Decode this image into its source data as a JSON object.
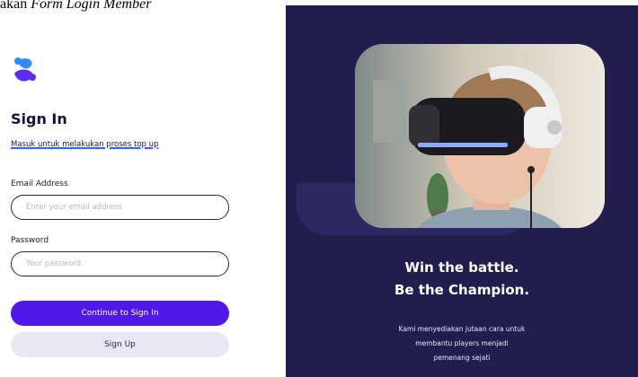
{
  "caption": {
    "prefix": "akan ",
    "form_italic": "Form",
    "login_italic": " Login Member"
  },
  "colors": {
    "primary": "#5118ea",
    "panel_bg": "#221d4c",
    "title": "#150e3f",
    "secondary_btn": "#e9e8f4",
    "accent_underline": "#2f68ff"
  },
  "login": {
    "logo_icon": "brand-s-logo-icon",
    "title": "Sign In",
    "subtitle": "Masuk untuk melakukan proses top up",
    "email": {
      "label": "Email Address",
      "placeholder": "Enter your email address",
      "value": ""
    },
    "password": {
      "label": "Password",
      "placeholder": "Your password",
      "value": ""
    },
    "primary_button": "Continue to Sign In",
    "secondary_button": "Sign Up"
  },
  "promo": {
    "headline_1": "Win the battle.",
    "headline_2": "Be the Champion.",
    "desc_1": "Kami menyediakan jutaan cara untuk",
    "desc_2": "membantu players menjadi",
    "desc_3": "pemenang sejati"
  }
}
